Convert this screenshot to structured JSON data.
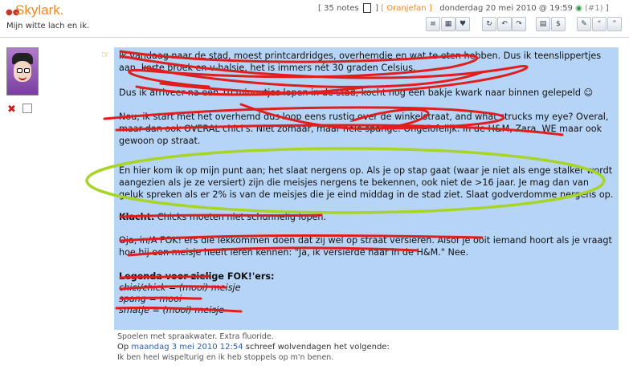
{
  "header": {
    "title": "Skylark.",
    "subtitle": "Mijn witte lach en ik.",
    "notes": "[ 35 notes",
    "user": "[ Oranjefan ]",
    "datetime": "donderdag 20 mei 2010 @ 19:59",
    "post_number": "(#1)",
    "bracket_close": "]"
  },
  "post": {
    "p1": "Ik vandaag naar de stad, moest printcardridges, overhemdje en wat te eten hebben. Dus ik teenslippertjes aan, korte broek en v-halsje, het is immers nét 30 graden Celsius.",
    "p2": "Dus ik arriveer na een 10 minuutjes lopen in de stad, kocht nog een bakje kwark naar binnen gelepeld",
    "p3": "Nou, ik start met het overhemd dus loop eens rustig over de winkelstraat, and what strucks my eye? Overal, maar dan ook OVERAL chici's. Niet zomaar, maar hele spange. Ongelofelijk. In de H&M, Zara, WE maar ook gewoon op straat.",
    "p4": "En hier kom ik op mijn punt aan; het slaat nergens op. Als je op stap gaat (waar je niet als enge stalker wordt aangezien als je ze versiert) zijn die meisjes nergens te bekennen, ook niet de >16 jaar. Je mag dan van geluk spreken als er 2% is van de meisjes die je eind middag in de stad ziet. Slaat godverdomme nergens op.",
    "p5_bold": "Klacht.",
    "p5": " Chicks moeten niet schunnelig lopen.",
    "p6": "Oja, in/A FOK!'ers die lekkommen doen dat zij wel op straat versieren. Alsof je ooit iemand hoort als je vraagt hoe hij een meisje heeft leren kennen: \"Ja, ik versierde haar in de H&M.\" Nee.",
    "legend_title": "Legenda voor zielige FOK!'ers:",
    "legend": [
      "chici/chick = (mooi) meisje",
      "spang = mooi",
      "smatje = (mooi) meisje"
    ]
  },
  "footer": {
    "signature": "Spoelen met spraakwater. Extra fluoride.",
    "quote_prefix": "Op",
    "quote_date": "maandag 3 mei 2010 12:54",
    "quote_suffix": "schreef wolvendagen het volgende:",
    "quote_text": "Ik ben heel wispelturig en ik heb stoppels op m'n benen."
  },
  "colors": {
    "accent": "#f08a24",
    "post_background": "#b6d5f6",
    "scribble_red": "#e01e1e",
    "highlight_green": "#a8d42a"
  }
}
